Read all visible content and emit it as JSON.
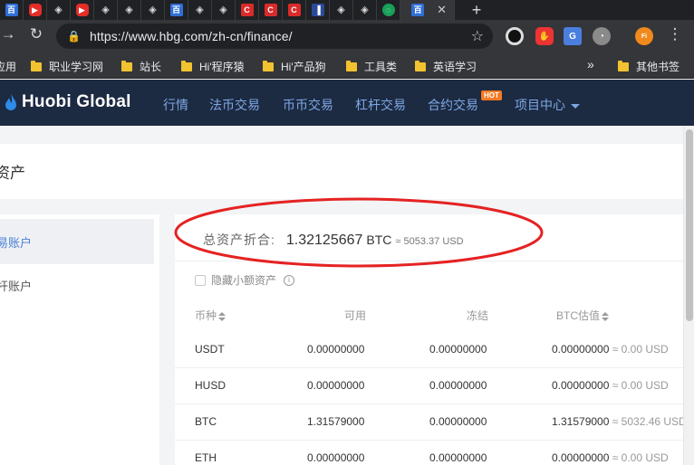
{
  "browser": {
    "url": "https://www.hbg.com/zh-cn/finance/",
    "tabs": [
      {
        "icon": "baidu-icon",
        "glyph": "百"
      },
      {
        "icon": "youtube-icon",
        "glyph": "▶"
      },
      {
        "icon": "unity-icon",
        "glyph": "◈"
      },
      {
        "icon": "youtube-icon",
        "glyph": "▶"
      },
      {
        "icon": "unity-icon",
        "glyph": "◈"
      },
      {
        "icon": "unity-icon",
        "glyph": "◈"
      },
      {
        "icon": "unity-icon",
        "glyph": "◈"
      },
      {
        "icon": "baidu-icon",
        "glyph": "百"
      },
      {
        "icon": "unity-icon",
        "glyph": "◈"
      },
      {
        "icon": "unity-icon",
        "glyph": "◈"
      },
      {
        "icon": "c-red-icon",
        "glyph": "C"
      },
      {
        "icon": "c-red-icon",
        "glyph": "C"
      },
      {
        "icon": "c-red-icon",
        "glyph": "C"
      },
      {
        "icon": "tool-icon",
        "glyph": "▐"
      },
      {
        "icon": "unity-icon",
        "glyph": "◈"
      },
      {
        "icon": "unity-icon",
        "glyph": "◈"
      },
      {
        "icon": "green-circle-icon",
        "glyph": "◌"
      },
      {
        "icon": "baidu-icon",
        "glyph": "百"
      }
    ],
    "active_tab_close": "✕",
    "new_tab": "+",
    "bookmarks": [
      {
        "label": "应用",
        "folder": false
      },
      {
        "label": "职业学习网",
        "folder": true
      },
      {
        "label": "站长",
        "folder": true
      },
      {
        "label": "Hi'程序猿",
        "folder": true
      },
      {
        "label": "Hi'产品狗",
        "folder": true
      },
      {
        "label": "工具类",
        "folder": true
      },
      {
        "label": "英语学习",
        "folder": true
      },
      {
        "label": "其他书签",
        "folder": true
      }
    ],
    "bookmarks_more": "»"
  },
  "site": {
    "logo_text": "Huobi Global",
    "nav": [
      {
        "label": "行情"
      },
      {
        "label": "法币交易"
      },
      {
        "label": "币币交易"
      },
      {
        "label": "杠杆交易"
      },
      {
        "label": "合约交易"
      },
      {
        "label": "项目中心"
      }
    ],
    "hot_badge": "HOT",
    "accent_color": "#7ea7e4",
    "header_bg": "#1c2a42"
  },
  "page": {
    "title": "资产",
    "sidebar": [
      {
        "label": "易账户",
        "active": true
      },
      {
        "label": "杆账户",
        "active": false
      }
    ],
    "total": {
      "label": "总资产折合:",
      "btc_value": "1.32125667",
      "btc_unit": "BTC",
      "usd_text": "≈ 5053.37 USD"
    },
    "hide_small_label": "隐藏小额资产",
    "columns": [
      "币种",
      "可用",
      "冻结",
      "BTC估值"
    ],
    "rows": [
      {
        "coin": "USDT",
        "available": "0.00000000",
        "frozen": "0.00000000",
        "btc": "0.00000000",
        "usd": "≈ 0.00 USD"
      },
      {
        "coin": "HUSD",
        "available": "0.00000000",
        "frozen": "0.00000000",
        "btc": "0.00000000",
        "usd": "≈ 0.00 USD"
      },
      {
        "coin": "BTC",
        "available": "1.31579000",
        "frozen": "0.00000000",
        "btc": "1.31579000",
        "usd": "≈ 5032.46 USD"
      },
      {
        "coin": "ETH",
        "available": "0.00000000",
        "frozen": "0.00000000",
        "btc": "0.00000000",
        "usd": "≈ 0.00 USD"
      }
    ]
  }
}
